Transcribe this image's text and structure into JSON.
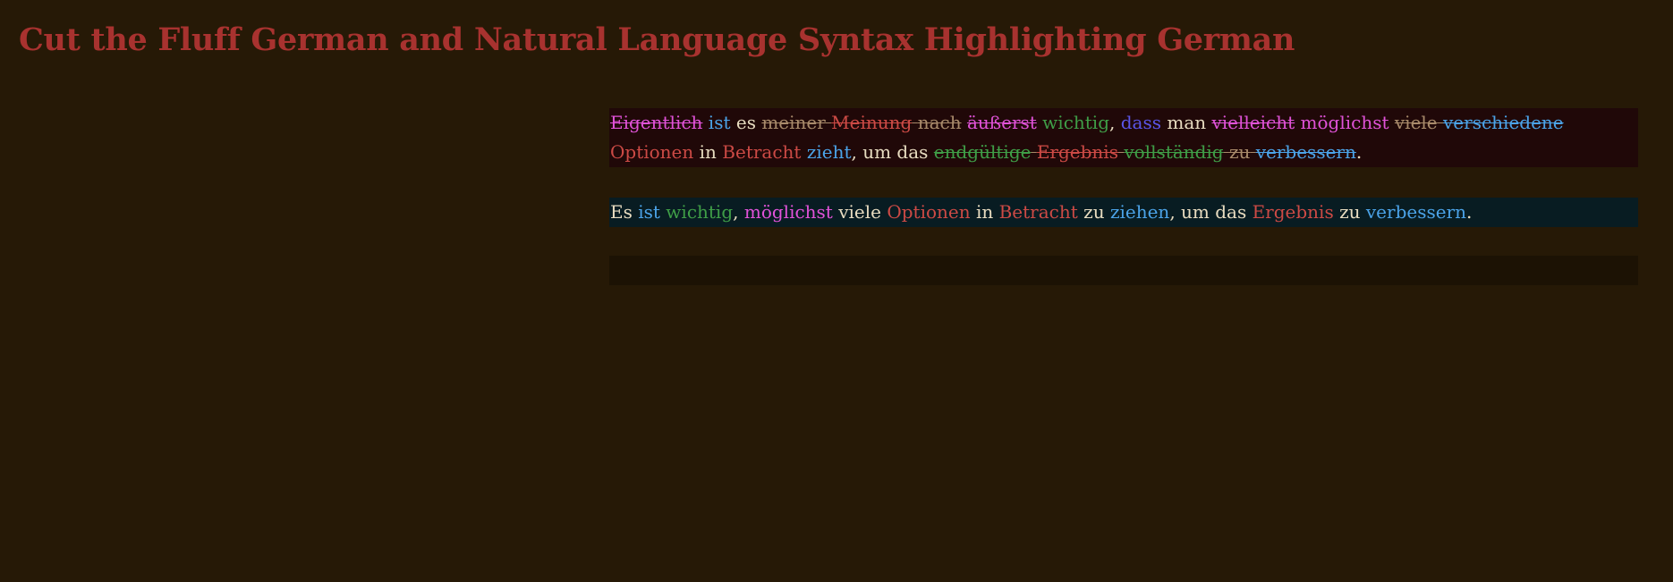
{
  "title": "Cut the Fluff German and Natural Language Syntax Highlighting German",
  "colors": {
    "background": "#261906",
    "title": "#a8322f",
    "plain": "#e8dcc0",
    "magenta": "#e052d8",
    "blue": "#4ba3e8",
    "green": "#3f9e47",
    "red": "#cc4a45",
    "tan": "#a88a6a",
    "purple": "#5a55e8"
  },
  "original": {
    "line1": [
      {
        "text": "Eigentlich",
        "color": "mag",
        "struck": true
      },
      {
        "text": " ",
        "color": "plain",
        "struck": false
      },
      {
        "text": "ist",
        "color": "blue",
        "struck": false
      },
      {
        "text": " es ",
        "color": "plain",
        "struck": false
      },
      {
        "text": "meiner",
        "color": "tan",
        "struck": true
      },
      {
        "text": " ",
        "color": "tan",
        "struck": true
      },
      {
        "text": "Meinung",
        "color": "red",
        "struck": true
      },
      {
        "text": " ",
        "color": "tan",
        "struck": true
      },
      {
        "text": "nach",
        "color": "tan",
        "struck": true
      },
      {
        "text": " ",
        "color": "plain",
        "struck": false
      },
      {
        "text": "äußerst",
        "color": "mag",
        "struck": true
      },
      {
        "text": " ",
        "color": "plain",
        "struck": false
      },
      {
        "text": "wichtig",
        "color": "green",
        "struck": false
      },
      {
        "text": ", ",
        "color": "plain",
        "struck": false
      },
      {
        "text": "dass",
        "color": "purple",
        "struck": false
      },
      {
        "text": " man ",
        "color": "plain",
        "struck": false
      },
      {
        "text": "vielleicht",
        "color": "mag",
        "struck": true
      },
      {
        "text": " ",
        "color": "plain",
        "struck": false
      },
      {
        "text": "möglichst",
        "color": "mag",
        "struck": false
      },
      {
        "text": " ",
        "color": "plain",
        "struck": false
      },
      {
        "text": "viele",
        "color": "tan",
        "struck": true
      },
      {
        "text": " ",
        "color": "tan",
        "struck": true
      },
      {
        "text": "verschiedene",
        "color": "blue",
        "struck": true
      }
    ],
    "line2": [
      {
        "text": "Optionen",
        "color": "red",
        "struck": false
      },
      {
        "text": " in ",
        "color": "plain",
        "struck": false
      },
      {
        "text": "Betracht",
        "color": "red",
        "struck": false
      },
      {
        "text": " ",
        "color": "plain",
        "struck": false
      },
      {
        "text": "zieht",
        "color": "blue",
        "struck": false
      },
      {
        "text": ", um das ",
        "color": "plain",
        "struck": false
      },
      {
        "text": "endgültige",
        "color": "green",
        "struck": true
      },
      {
        "text": " ",
        "color": "tan",
        "struck": true
      },
      {
        "text": "Ergebnis",
        "color": "red",
        "struck": true
      },
      {
        "text": " ",
        "color": "tan",
        "struck": true
      },
      {
        "text": "vollständig",
        "color": "green",
        "struck": true
      },
      {
        "text": " ",
        "color": "tan",
        "struck": true
      },
      {
        "text": "zu",
        "color": "tan",
        "struck": true
      },
      {
        "text": " ",
        "color": "tan",
        "struck": true
      },
      {
        "text": "verbessern",
        "color": "blue",
        "struck": true
      },
      {
        "text": ".",
        "color": "plain",
        "struck": false
      }
    ]
  },
  "corrected": {
    "line1": [
      {
        "text": "Es ",
        "color": "plain",
        "struck": false
      },
      {
        "text": "ist",
        "color": "blue",
        "struck": false
      },
      {
        "text": " ",
        "color": "plain",
        "struck": false
      },
      {
        "text": "wichtig",
        "color": "green",
        "struck": false
      },
      {
        "text": ", ",
        "color": "plain",
        "struck": false
      },
      {
        "text": "möglichst",
        "color": "mag",
        "struck": false
      },
      {
        "text": " viele ",
        "color": "plain",
        "struck": false
      },
      {
        "text": "Optionen",
        "color": "red",
        "struck": false
      },
      {
        "text": " in ",
        "color": "plain",
        "struck": false
      },
      {
        "text": "Betracht",
        "color": "red",
        "struck": false
      },
      {
        "text": " zu ",
        "color": "plain",
        "struck": false
      },
      {
        "text": "ziehen",
        "color": "blue",
        "struck": false
      },
      {
        "text": ", um das ",
        "color": "plain",
        "struck": false
      },
      {
        "text": "Ergebnis",
        "color": "red",
        "struck": false
      },
      {
        "text": " zu ",
        "color": "plain",
        "struck": false
      },
      {
        "text": "verbessern",
        "color": "blue",
        "struck": false
      },
      {
        "text": ".",
        "color": "plain",
        "struck": false
      }
    ]
  }
}
